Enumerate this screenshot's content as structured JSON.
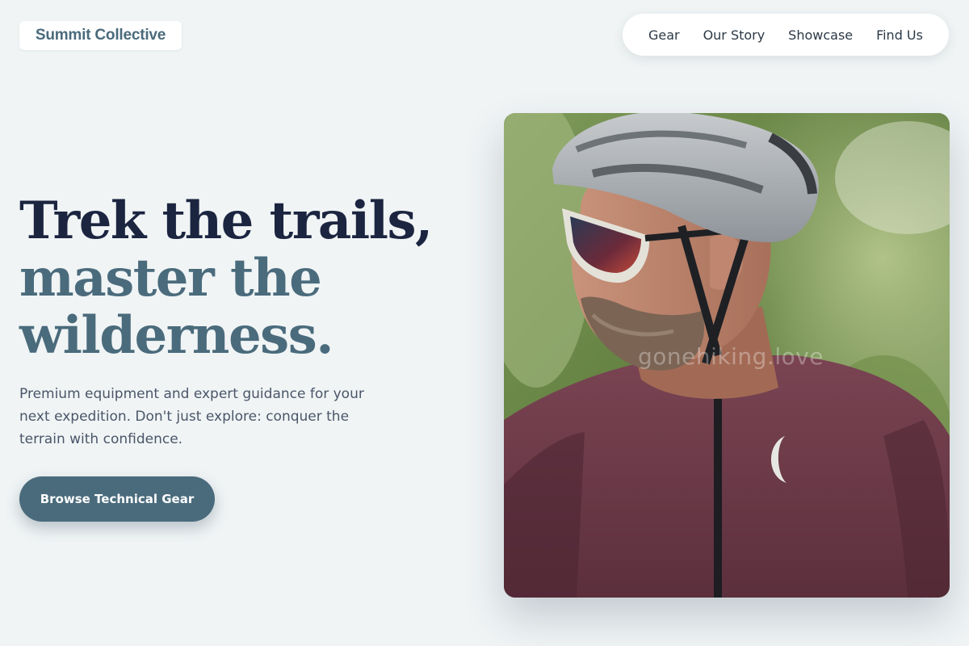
{
  "brand": {
    "name": "Summit Collective"
  },
  "nav": {
    "items": [
      "Gear",
      "Our Story",
      "Showcase",
      "Find Us"
    ]
  },
  "hero": {
    "headline": {
      "line1": "Trek the trails,",
      "line2": "master the",
      "line3": "wilderness."
    },
    "subtitle": "Premium equipment and expert guidance for your next expedition. Don't just explore: conquer the terrain with confidence.",
    "cta_label": "Browse Technical Gear",
    "image": {
      "subject": "cyclist-photo",
      "watermark": "gonehiking.love"
    }
  },
  "colors": {
    "background": "#f0f4f5",
    "primary": "#4a6b7c",
    "heading_dark": "#1b2540",
    "body_text": "#4a5668"
  }
}
